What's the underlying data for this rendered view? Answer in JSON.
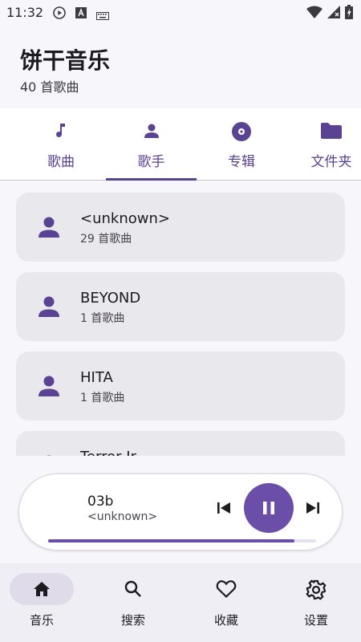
{
  "status_bar": {
    "time": "11:32",
    "icons": [
      "play-circle-icon",
      "a-box-icon",
      "keyboard-icon",
      "wifi-icon",
      "signal-icon",
      "battery-icon"
    ]
  },
  "header": {
    "title": "饼干音乐",
    "subtitle": "40 首歌曲"
  },
  "tabs": [
    {
      "label": "歌曲",
      "icon": "music-note-icon"
    },
    {
      "label": "歌手",
      "icon": "person-icon",
      "active": true
    },
    {
      "label": "专辑",
      "icon": "album-icon"
    },
    {
      "label": "文件夹",
      "icon": "folder-icon"
    }
  ],
  "artists": [
    {
      "name": "<unknown>",
      "count": "29 首歌曲"
    },
    {
      "name": "BEYOND",
      "count": "1 首歌曲"
    },
    {
      "name": "HITA",
      "count": "1 首歌曲"
    },
    {
      "name": "Terror Jr",
      "count": ""
    }
  ],
  "player": {
    "track": "03b",
    "artist": "<unknown>",
    "progress": 0.92
  },
  "bottom_nav": [
    {
      "label": "音乐",
      "icon": "home-icon",
      "active": true
    },
    {
      "label": "搜索",
      "icon": "search-icon"
    },
    {
      "label": "收藏",
      "icon": "heart-icon"
    },
    {
      "label": "设置",
      "icon": "gear-icon"
    }
  ],
  "colors": {
    "accent": "#5b4394",
    "accent_play": "#6a4ea8",
    "card_bg": "#e9e8ed",
    "nav_active_pill": "#e0dbe9"
  }
}
